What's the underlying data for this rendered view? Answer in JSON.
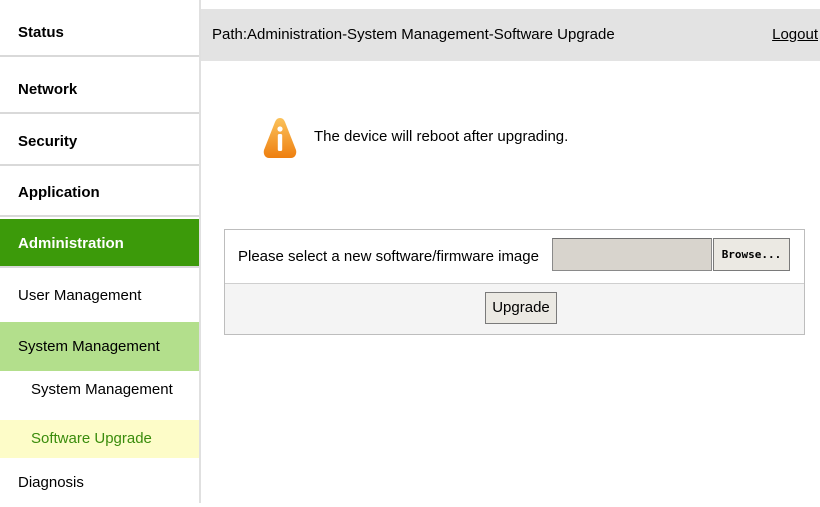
{
  "sidebar": {
    "main_items": [
      {
        "label": "Status"
      },
      {
        "label": "Network"
      },
      {
        "label": "Security"
      },
      {
        "label": "Application"
      },
      {
        "label": "Administration",
        "active": true
      }
    ],
    "sub_items": [
      {
        "label": "User Management"
      },
      {
        "label": "System Management",
        "active": true
      },
      {
        "label": "Diagnosis"
      }
    ],
    "subsub_items": [
      {
        "label": "System Management"
      },
      {
        "label": "Software Upgrade",
        "active": true
      }
    ]
  },
  "header": {
    "path": "Path:Administration-System Management-Software Upgrade",
    "logout": "Logout"
  },
  "notice": {
    "icon": "warning-icon",
    "text": "The device will reboot after upgrading."
  },
  "upgrade_form": {
    "file_label": "Please select a new software/firmware image",
    "file_value": "",
    "browse_label": "Browse...",
    "upgrade_label": "Upgrade"
  },
  "colors": {
    "active_main": "#3c9a0a",
    "active_sub": "#b3df8c",
    "active_subsub_bg": "#fdfcc8",
    "active_subsub_text": "#3a8c0c",
    "warning": "#f59a1b"
  }
}
